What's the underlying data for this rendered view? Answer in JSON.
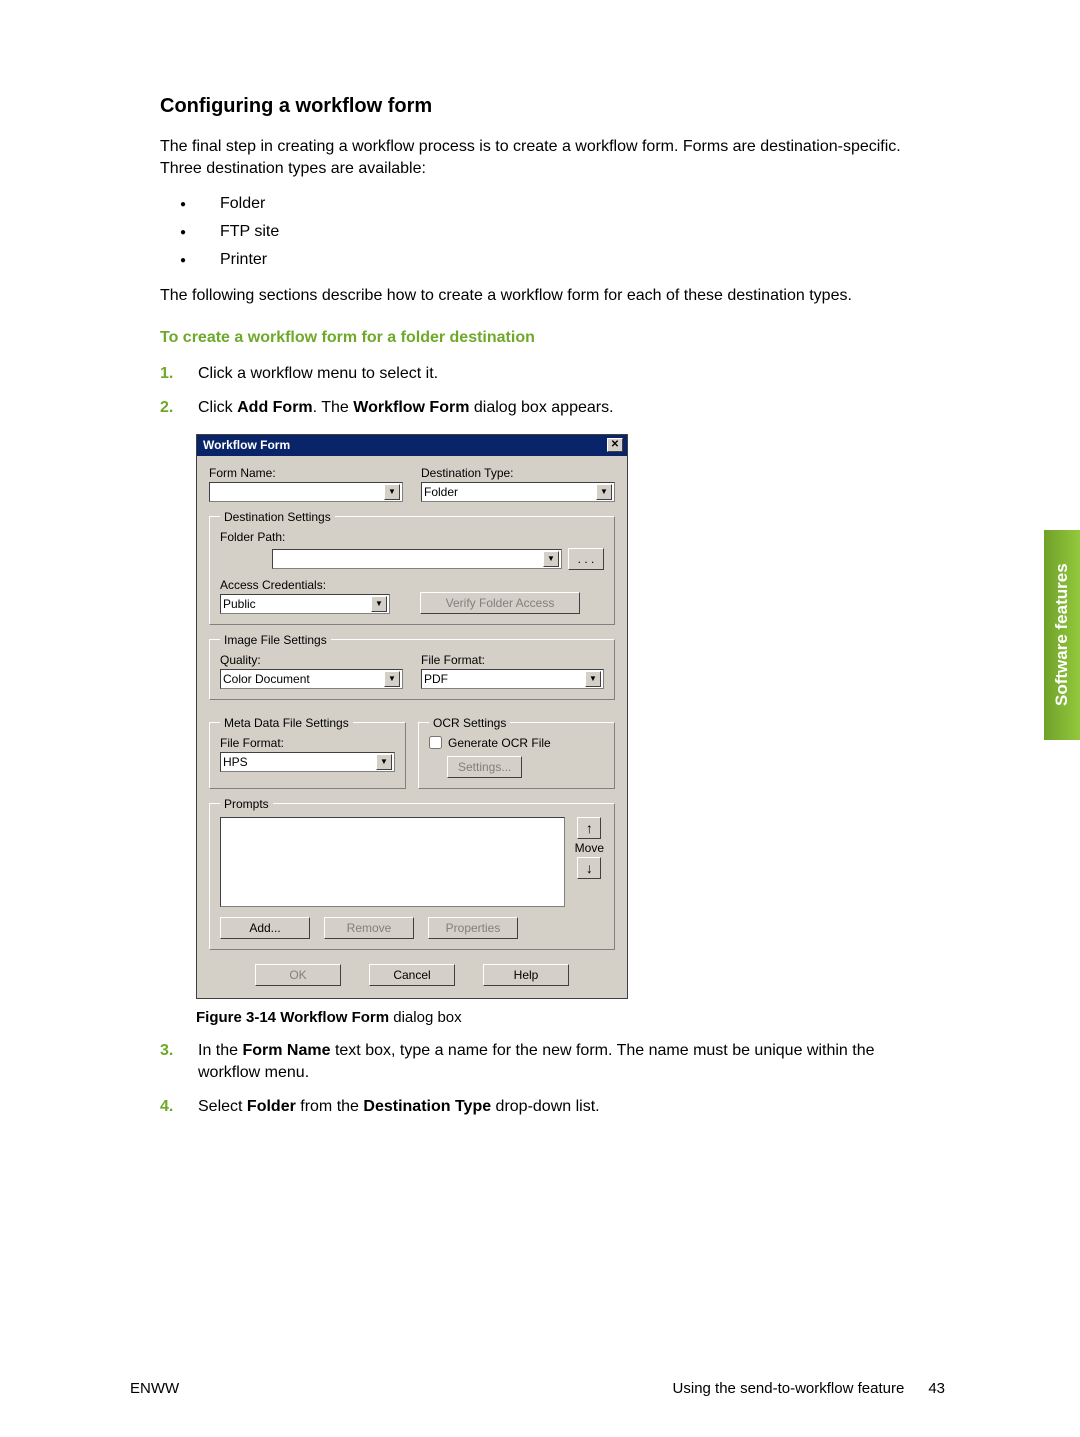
{
  "heading": "Configuring a workflow form",
  "intro": "The final step in creating a workflow process is to create a workflow form. Forms are destination-specific. Three destination types are available:",
  "destTypes": [
    "Folder",
    "FTP site",
    "Printer"
  ],
  "intro2": "The following sections describe how to create a workflow form for each of these destination types.",
  "subHeading": "To create a workflow form for a folder destination",
  "steps": {
    "s1": "Click a workflow menu to select it.",
    "s2_a": "Click ",
    "s2_b": "Add Form",
    "s2_c": ". The ",
    "s2_d": "Workflow Form",
    "s2_e": " dialog box appears.",
    "s3_a": "In the ",
    "s3_b": "Form Name",
    "s3_c": " text box, type a name for the new form. The name must be unique within the workflow menu.",
    "s4_a": "Select ",
    "s4_b": "Folder",
    "s4_c": " from the ",
    "s4_d": "Destination Type",
    "s4_e": " drop-down list."
  },
  "dialog": {
    "title": "Workflow Form",
    "formNameLabel": "Form Name:",
    "formNameValue": "",
    "destTypeLabel": "Destination Type:",
    "destTypeValue": "Folder",
    "destSettings": {
      "legend": "Destination Settings",
      "folderPathLabel": "Folder Path:",
      "folderPathValue": "",
      "browseBtn": ". . .",
      "accessLabel": "Access Credentials:",
      "accessValue": "Public",
      "verifyBtn": "Verify Folder Access"
    },
    "imageSettings": {
      "legend": "Image File Settings",
      "qualityLabel": "Quality:",
      "qualityValue": "Color Document",
      "fileFormatLabel": "File Format:",
      "fileFormatValue": "PDF"
    },
    "metaSettings": {
      "legend": "Meta Data File Settings",
      "fileFormatLabel": "File Format:",
      "fileFormatValue": "HPS"
    },
    "ocrSettings": {
      "legend": "OCR Settings",
      "checkboxLabel": "Generate OCR File",
      "settingsBtn": "Settings..."
    },
    "prompts": {
      "legend": "Prompts",
      "moveLabel": "Move",
      "addBtn": "Add...",
      "removeBtn": "Remove",
      "propertiesBtn": "Properties"
    },
    "okBtn": "OK",
    "cancelBtn": "Cancel",
    "helpBtn": "Help"
  },
  "caption": {
    "prefix": "Figure 3-14  ",
    "bold": "Workflow Form",
    "suffix": " dialog box"
  },
  "sideTab": "Software features",
  "footer": {
    "left": "ENWW",
    "rightText": "Using the send-to-workflow feature",
    "pageNum": "43"
  }
}
